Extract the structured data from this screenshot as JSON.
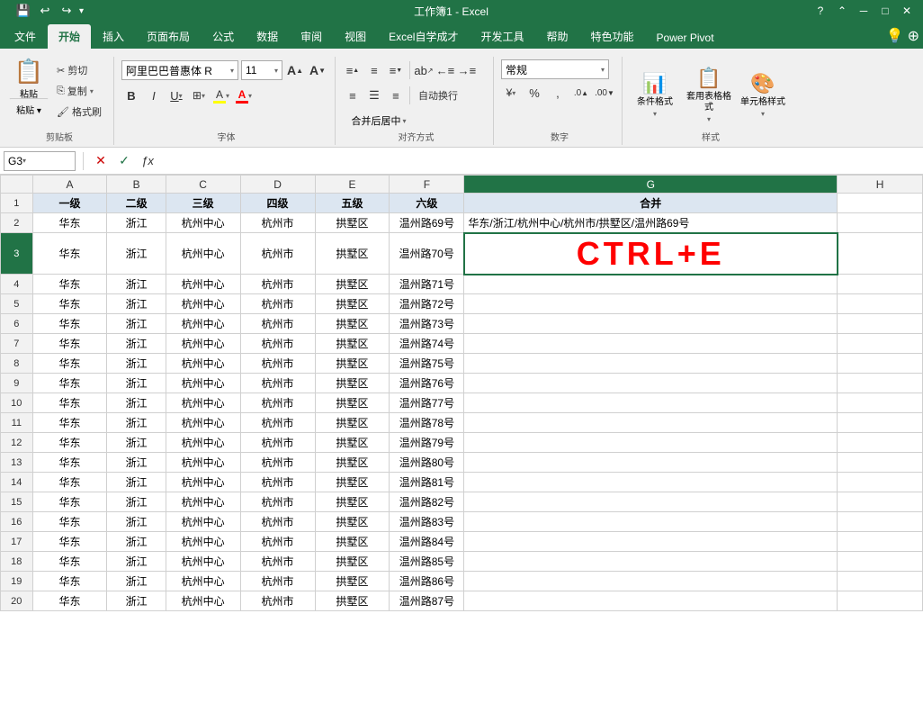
{
  "titlebar": {
    "title": "工作簿1 - Excel",
    "quickaccess": [
      "💾",
      "↩",
      "↪"
    ]
  },
  "menutabs": [
    {
      "id": "file",
      "label": "文件"
    },
    {
      "id": "home",
      "label": "开始",
      "active": true
    },
    {
      "id": "insert",
      "label": "插入"
    },
    {
      "id": "layout",
      "label": "页面布局"
    },
    {
      "id": "formulas",
      "label": "公式"
    },
    {
      "id": "data",
      "label": "数据"
    },
    {
      "id": "review",
      "label": "审阅"
    },
    {
      "id": "view",
      "label": "视图"
    },
    {
      "id": "excel-learn",
      "label": "Excel自学成才"
    },
    {
      "id": "developer",
      "label": "开发工具"
    },
    {
      "id": "help",
      "label": "帮助"
    },
    {
      "id": "special",
      "label": "特色功能"
    },
    {
      "id": "powerpivot",
      "label": "Power Pivot"
    }
  ],
  "ribbon": {
    "clipboard": {
      "label": "剪贴板",
      "paste": "粘贴",
      "cut": "剪切",
      "copy": "复制",
      "format_painter": "格式刷"
    },
    "font": {
      "label": "字体",
      "font_name": "阿里巴巴普惠体 R",
      "font_size": "11",
      "bold": "B",
      "italic": "I",
      "underline": "U",
      "border": "⊞",
      "fill_color": "A",
      "font_color": "A",
      "increase_font": "A",
      "decrease_font": "A"
    },
    "alignment": {
      "label": "对齐方式",
      "auto_wrap": "自动换行",
      "merge": "合并后居中",
      "indent_left": "←",
      "indent_right": "→"
    },
    "number": {
      "label": "数字",
      "format": "常规",
      "percent": "%",
      "comma": ",",
      "increase_decimal": ".0",
      "decrease_decimal": ".00"
    },
    "styles": {
      "label": "样式",
      "conditional": "条件格式"
    }
  },
  "formulabar": {
    "cellref": "G3",
    "formula": ""
  },
  "columns": {
    "headers": [
      "",
      "A",
      "B",
      "C",
      "D",
      "E",
      "F",
      "G",
      "H"
    ],
    "widths": [
      30,
      70,
      55,
      70,
      70,
      70,
      70,
      350,
      80
    ]
  },
  "rows": [
    {
      "num": "1",
      "cells": [
        "一级",
        "二级",
        "三级",
        "四级",
        "五级",
        "六级",
        "合并"
      ],
      "is_header": true
    },
    {
      "num": "2",
      "cells": [
        "华东",
        "浙江",
        "杭州中心",
        "杭州市",
        "拱墅区",
        "温州路69号",
        "华东/浙江/杭州中心/杭州市/拱墅区/温州路69号"
      ]
    },
    {
      "num": "3",
      "cells": [
        "华东",
        "浙江",
        "杭州中心",
        "杭州市",
        "拱墅区",
        "温州路70号",
        "CTRL+E"
      ],
      "is_ctrle": true
    },
    {
      "num": "4",
      "cells": [
        "华东",
        "浙江",
        "杭州中心",
        "杭州市",
        "拱墅区",
        "温州路71号",
        ""
      ]
    },
    {
      "num": "5",
      "cells": [
        "华东",
        "浙江",
        "杭州中心",
        "杭州市",
        "拱墅区",
        "温州路72号",
        ""
      ]
    },
    {
      "num": "6",
      "cells": [
        "华东",
        "浙江",
        "杭州中心",
        "杭州市",
        "拱墅区",
        "温州路73号",
        ""
      ]
    },
    {
      "num": "7",
      "cells": [
        "华东",
        "浙江",
        "杭州中心",
        "杭州市",
        "拱墅区",
        "温州路74号",
        ""
      ]
    },
    {
      "num": "8",
      "cells": [
        "华东",
        "浙江",
        "杭州中心",
        "杭州市",
        "拱墅区",
        "温州路75号",
        ""
      ]
    },
    {
      "num": "9",
      "cells": [
        "华东",
        "浙江",
        "杭州中心",
        "杭州市",
        "拱墅区",
        "温州路76号",
        ""
      ]
    },
    {
      "num": "10",
      "cells": [
        "华东",
        "浙江",
        "杭州中心",
        "杭州市",
        "拱墅区",
        "温州路77号",
        ""
      ]
    },
    {
      "num": "11",
      "cells": [
        "华东",
        "浙江",
        "杭州中心",
        "杭州市",
        "拱墅区",
        "温州路78号",
        ""
      ]
    },
    {
      "num": "12",
      "cells": [
        "华东",
        "浙江",
        "杭州中心",
        "杭州市",
        "拱墅区",
        "温州路79号",
        ""
      ]
    },
    {
      "num": "13",
      "cells": [
        "华东",
        "浙江",
        "杭州中心",
        "杭州市",
        "拱墅区",
        "温州路80号",
        ""
      ]
    },
    {
      "num": "14",
      "cells": [
        "华东",
        "浙江",
        "杭州中心",
        "杭州市",
        "拱墅区",
        "温州路81号",
        ""
      ]
    },
    {
      "num": "15",
      "cells": [
        "华东",
        "浙江",
        "杭州中心",
        "杭州市",
        "拱墅区",
        "温州路82号",
        ""
      ]
    },
    {
      "num": "16",
      "cells": [
        "华东",
        "浙江",
        "杭州中心",
        "杭州市",
        "拱墅区",
        "温州路83号",
        ""
      ]
    },
    {
      "num": "17",
      "cells": [
        "华东",
        "浙江",
        "杭州中心",
        "杭州市",
        "拱墅区",
        "温州路84号",
        ""
      ]
    },
    {
      "num": "18",
      "cells": [
        "华东",
        "浙江",
        "杭州中心",
        "杭州市",
        "拱墅区",
        "温州路85号",
        ""
      ]
    },
    {
      "num": "19",
      "cells": [
        "华东",
        "浙江",
        "杭州中心",
        "杭州市",
        "拱墅区",
        "温州路86号",
        ""
      ]
    },
    {
      "num": "20",
      "cells": [
        "华东",
        "浙江",
        "杭州中心",
        "杭州市",
        "拱墅区",
        "温州路87号",
        ""
      ]
    }
  ],
  "cursor": {
    "row": 3,
    "col": "G"
  },
  "ctrle_text": "CTRL+E",
  "colors": {
    "excel_green": "#217346",
    "header_bg": "#dce6f1",
    "ctrle_color": "#ff0000"
  }
}
